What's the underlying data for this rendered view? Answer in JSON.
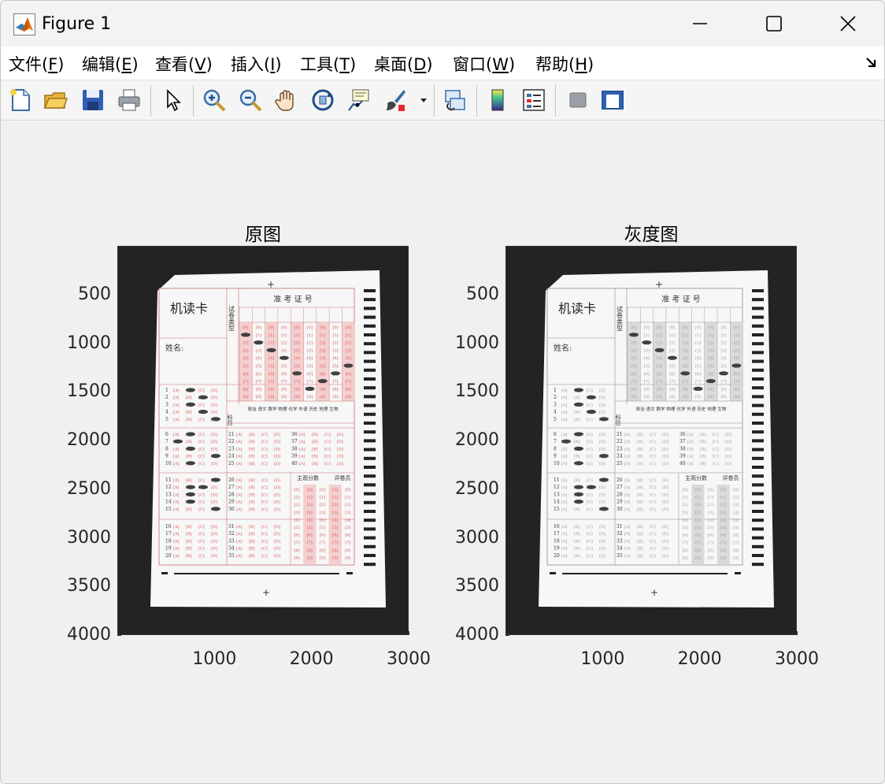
{
  "window": {
    "title": "Figure 1"
  },
  "menu": [
    {
      "label": "文件(",
      "acc": "F",
      "tail": ")"
    },
    {
      "label": "编辑(",
      "acc": "E",
      "tail": ")"
    },
    {
      "label": "查看(",
      "acc": "V",
      "tail": ")"
    },
    {
      "label": "插入(",
      "acc": "I",
      "tail": ")"
    },
    {
      "label": "工具(",
      "acc": "T",
      "tail": ")"
    },
    {
      "label": "桌面(",
      "acc": "D",
      "tail": ")"
    },
    {
      "label": "窗口(",
      "acc": "W",
      "tail": ")"
    },
    {
      "label": "帮助(",
      "acc": "H",
      "tail": ")"
    }
  ],
  "toolbar_icons": [
    "new-figure-icon",
    "open-file-icon",
    "save-icon",
    "print-icon",
    "edit-plot-arrow-icon",
    "zoom-in-icon",
    "zoom-out-icon",
    "pan-hand-icon",
    "rotate-3d-icon",
    "data-cursor-icon",
    "brush-icon",
    "link-plot-icon",
    "colorbar-icon",
    "legend-icon",
    "hide-plot-tools-icon",
    "show-plot-tools-icon"
  ],
  "axes": [
    {
      "title": "原图",
      "variant": "color",
      "y_ticks": [
        "500",
        "1000",
        "1500",
        "2000",
        "2500",
        "3000",
        "3500",
        "4000"
      ],
      "x_ticks": [
        "1000",
        "2000",
        "3000"
      ]
    },
    {
      "title": "灰度图",
      "variant": "gray",
      "y_ticks": [
        "500",
        "1000",
        "1500",
        "2000",
        "2500",
        "3000",
        "3500",
        "4000"
      ],
      "x_ticks": [
        "1000",
        "2000",
        "3000"
      ]
    }
  ],
  "sheet": {
    "header_title": "机读卡",
    "exam_id_label": "准 考 证 号",
    "paper_type_label": "试卷类型",
    "name_label": "姓名:",
    "subject_label": "科目",
    "subjects": "政治 语文 数学 物理 化学 外语 历史 地理 生物",
    "subjective_score_label": "主观分数",
    "grader_label": "评卷员",
    "crosshair": "+"
  },
  "colors": {
    "accent_red": "#d9534f",
    "sheet_bg": "#f7f7f7",
    "dark_bg": "#232323"
  }
}
